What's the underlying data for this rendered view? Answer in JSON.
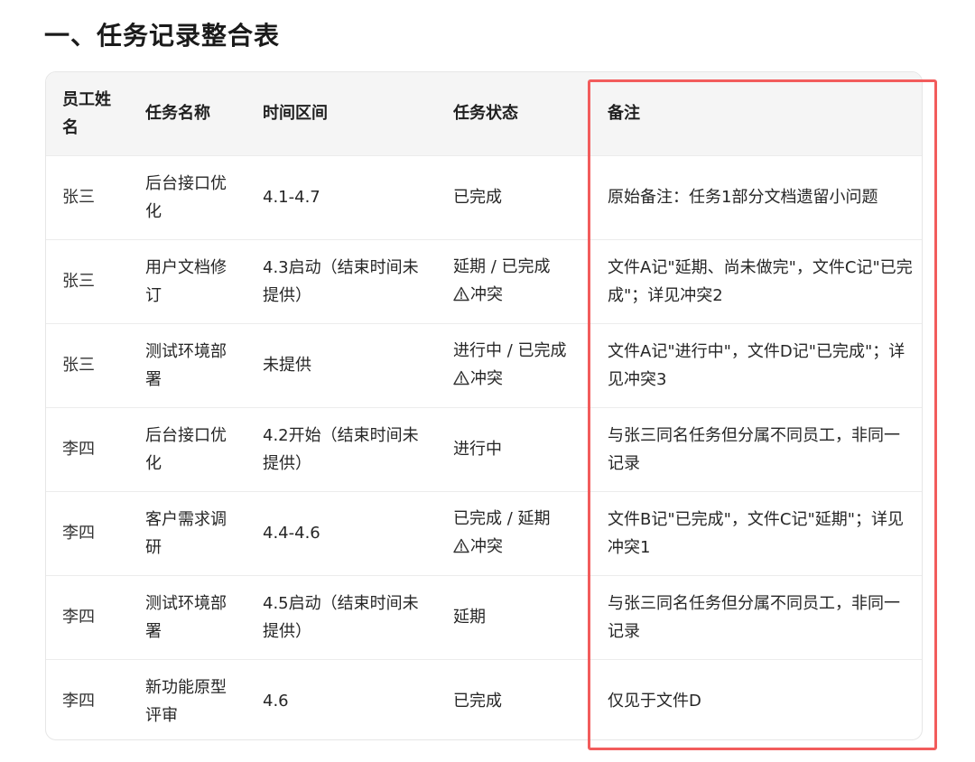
{
  "heading": "一、任务记录整合表",
  "table": {
    "headers": [
      "员工姓名",
      "任务名称",
      "时间区间",
      "任务状态",
      "备注"
    ],
    "conflict_label": "冲突",
    "rows": [
      {
        "employee": "张三",
        "task": "后台接口优化",
        "period": "4.1-4.7",
        "status": "已完成",
        "conflict": false,
        "note": "原始备注：任务1部分文档遗留小问题"
      },
      {
        "employee": "张三",
        "task": "用户文档修订",
        "period": "4.3启动（结束时间未提供）",
        "status": "延期 / 已完成",
        "conflict": true,
        "note": "文件A记\"延期、尚未做完\"，文件C记\"已完成\"；详见冲突2"
      },
      {
        "employee": "张三",
        "task": "测试环境部署",
        "period": "未提供",
        "status": "进行中 / 已完成",
        "conflict": true,
        "note": "文件A记\"进行中\"，文件D记\"已完成\"；详见冲突3"
      },
      {
        "employee": "李四",
        "task": "后台接口优化",
        "period": "4.2开始（结束时间未提供）",
        "status": "进行中",
        "conflict": false,
        "note": "与张三同名任务但分属不同员工，非同一记录"
      },
      {
        "employee": "李四",
        "task": "客户需求调研",
        "period": "4.4-4.6",
        "status": "已完成 / 延期",
        "conflict": true,
        "note": "文件B记\"已完成\"，文件C记\"延期\"；详见冲突1"
      },
      {
        "employee": "李四",
        "task": "测试环境部署",
        "period": "4.5启动（结束时间未提供）",
        "status": "延期",
        "conflict": false,
        "note": "与张三同名任务但分属不同员工，非同一记录"
      },
      {
        "employee": "李四",
        "task": "新功能原型评审",
        "period": "4.6",
        "status": "已完成",
        "conflict": false,
        "note": "仅见于文件D"
      }
    ]
  },
  "colors": {
    "highlight_border": "#f25c5c",
    "header_bg": "#f5f5f5",
    "row_divider": "#ececec"
  },
  "icons": {
    "conflict": "warning-triangle-icon"
  }
}
